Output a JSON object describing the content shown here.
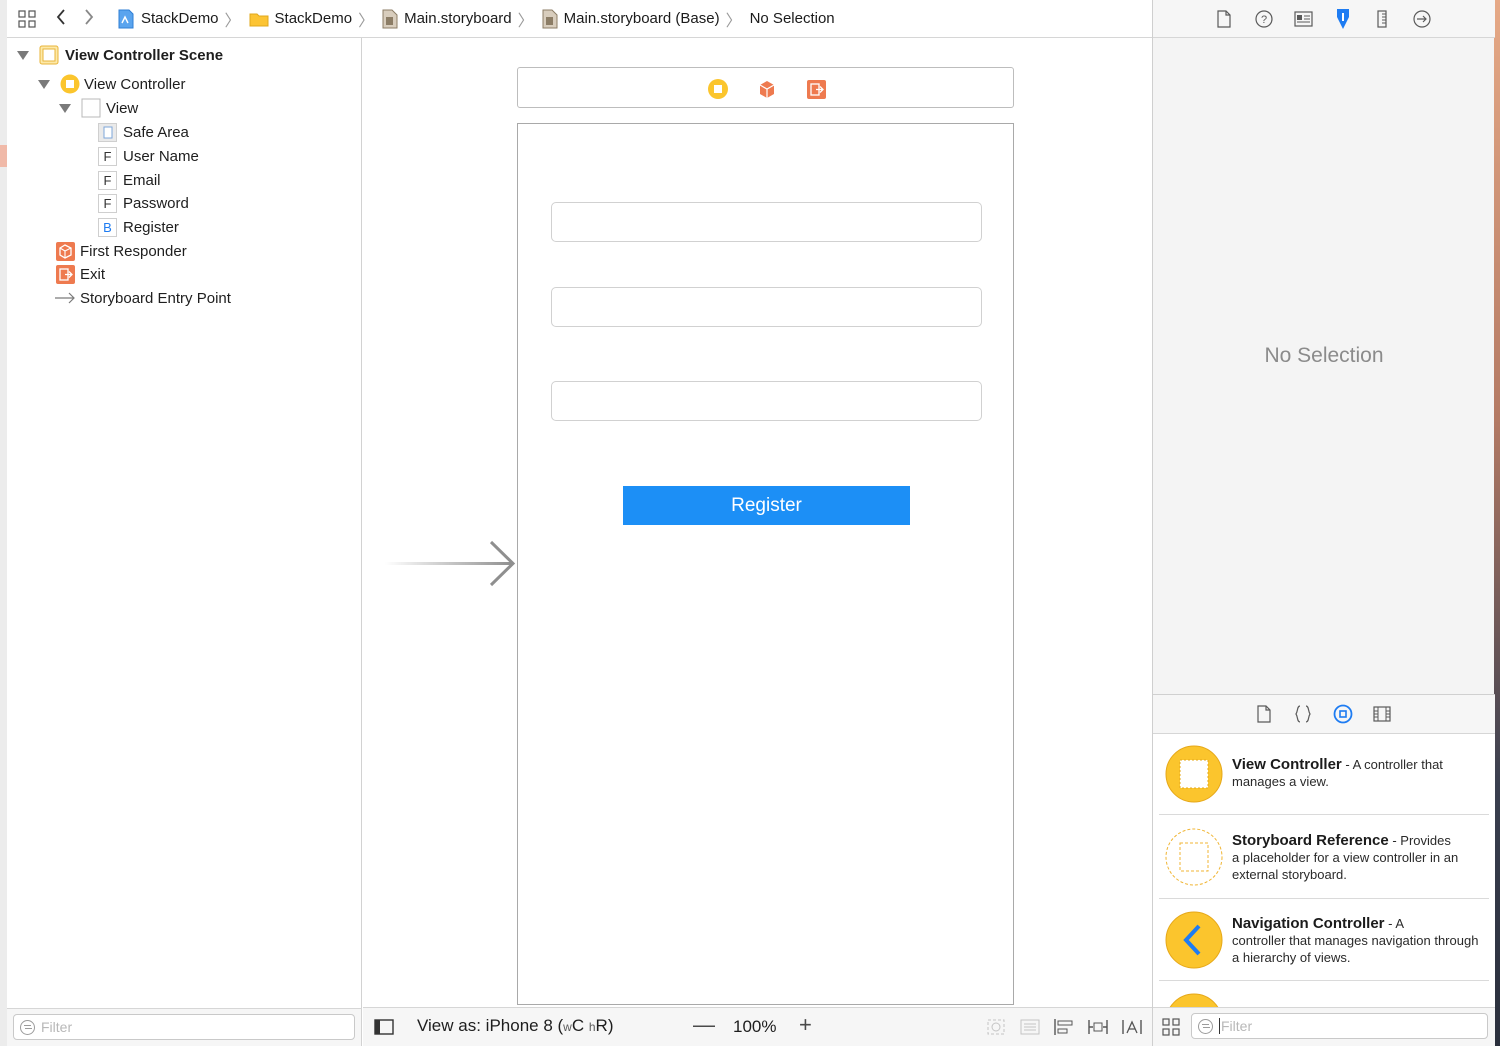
{
  "breadcrumb": {
    "items": [
      "StackDemo",
      "StackDemo",
      "Main.storyboard",
      "Main.storyboard (Base)",
      "No Selection"
    ]
  },
  "outline": {
    "scene": "View Controller Scene",
    "view_controller": "View Controller",
    "view": "View",
    "children": [
      {
        "badge": "",
        "label": "Safe Area"
      },
      {
        "badge": "F",
        "label": "User Name"
      },
      {
        "badge": "F",
        "label": "Email"
      },
      {
        "badge": "F",
        "label": "Password"
      },
      {
        "badge": "B",
        "label": "Register"
      }
    ],
    "first_responder": "First Responder",
    "exit": "Exit",
    "entry_point": "Storyboard Entry Point",
    "filter_placeholder": "Filter"
  },
  "canvas": {
    "register_button": "Register",
    "view_as_prefix": "View as: iPhone 8 (",
    "view_as_w": "w",
    "view_as_c": "C",
    "view_as_h": "h",
    "view_as_r": "R",
    "view_as_suffix": ")",
    "zoom": "100%",
    "zoom_out": "—",
    "zoom_in": "+"
  },
  "inspector": {
    "no_selection": "No Selection",
    "filter_placeholder": "Filter"
  },
  "library": [
    {
      "title": "View Controller",
      "desc_line1": " - A controller that",
      "desc_rest": "manages a view."
    },
    {
      "title": "Storyboard Reference",
      "desc_line1": " - Provides",
      "desc_rest": "a placeholder for a view controller in an external storyboard."
    },
    {
      "title": "Navigation Controller",
      "desc_line1": " - A",
      "desc_rest": "controller that manages navigation through a hierarchy of views."
    }
  ],
  "colors": {
    "accent_blue": "#1c8ff6",
    "vc_yellow": "#fbc52d",
    "responder_orange": "#ee7a4f",
    "toolbar_blue": "#1e7cf2"
  }
}
